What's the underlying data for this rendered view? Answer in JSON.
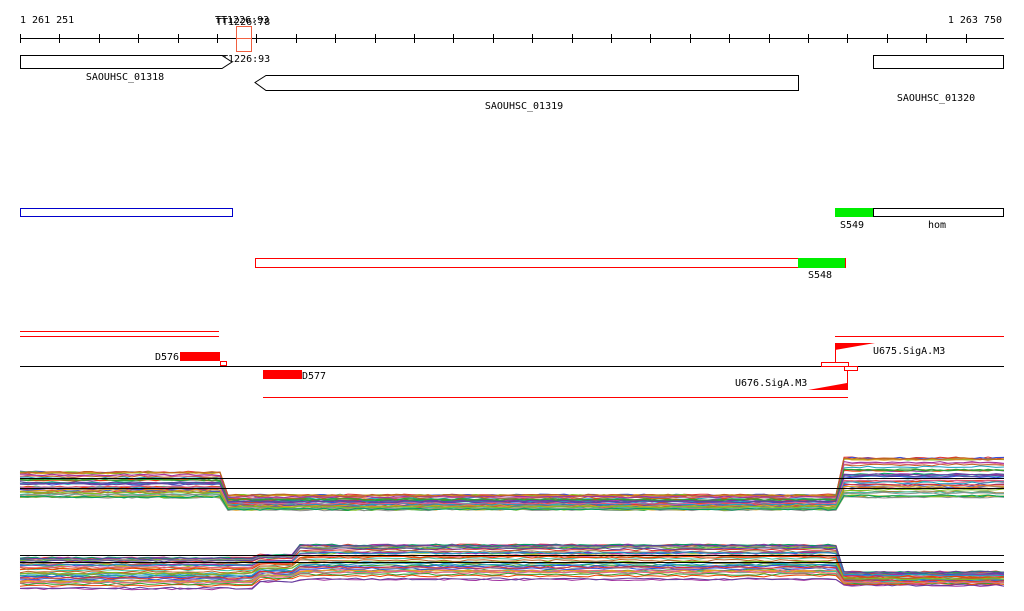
{
  "axis": {
    "start_label": "1 261 251",
    "end_label": "1 263 750"
  },
  "markers": {
    "top_label_a": "TT1226:93",
    "top_label_b": "TT1226:78",
    "bottom_label": "TT1226:93"
  },
  "genes": [
    {
      "name": "SAOUHSC_01318",
      "strand": "+"
    },
    {
      "name": "SAOUHSC_01319",
      "strand": "-"
    },
    {
      "name": "SAOUHSC_01320",
      "strand": "+"
    }
  ],
  "features": {
    "s549": "S549",
    "hom": "hom",
    "s548": "S548",
    "d576": "D576",
    "d577": "D577",
    "u675": "U675.SigA.M3",
    "u676": "U676.SigA.M3"
  },
  "colors": {
    "red": "#ff0000",
    "green": "#00ee00",
    "blue": "#0000cc"
  }
}
